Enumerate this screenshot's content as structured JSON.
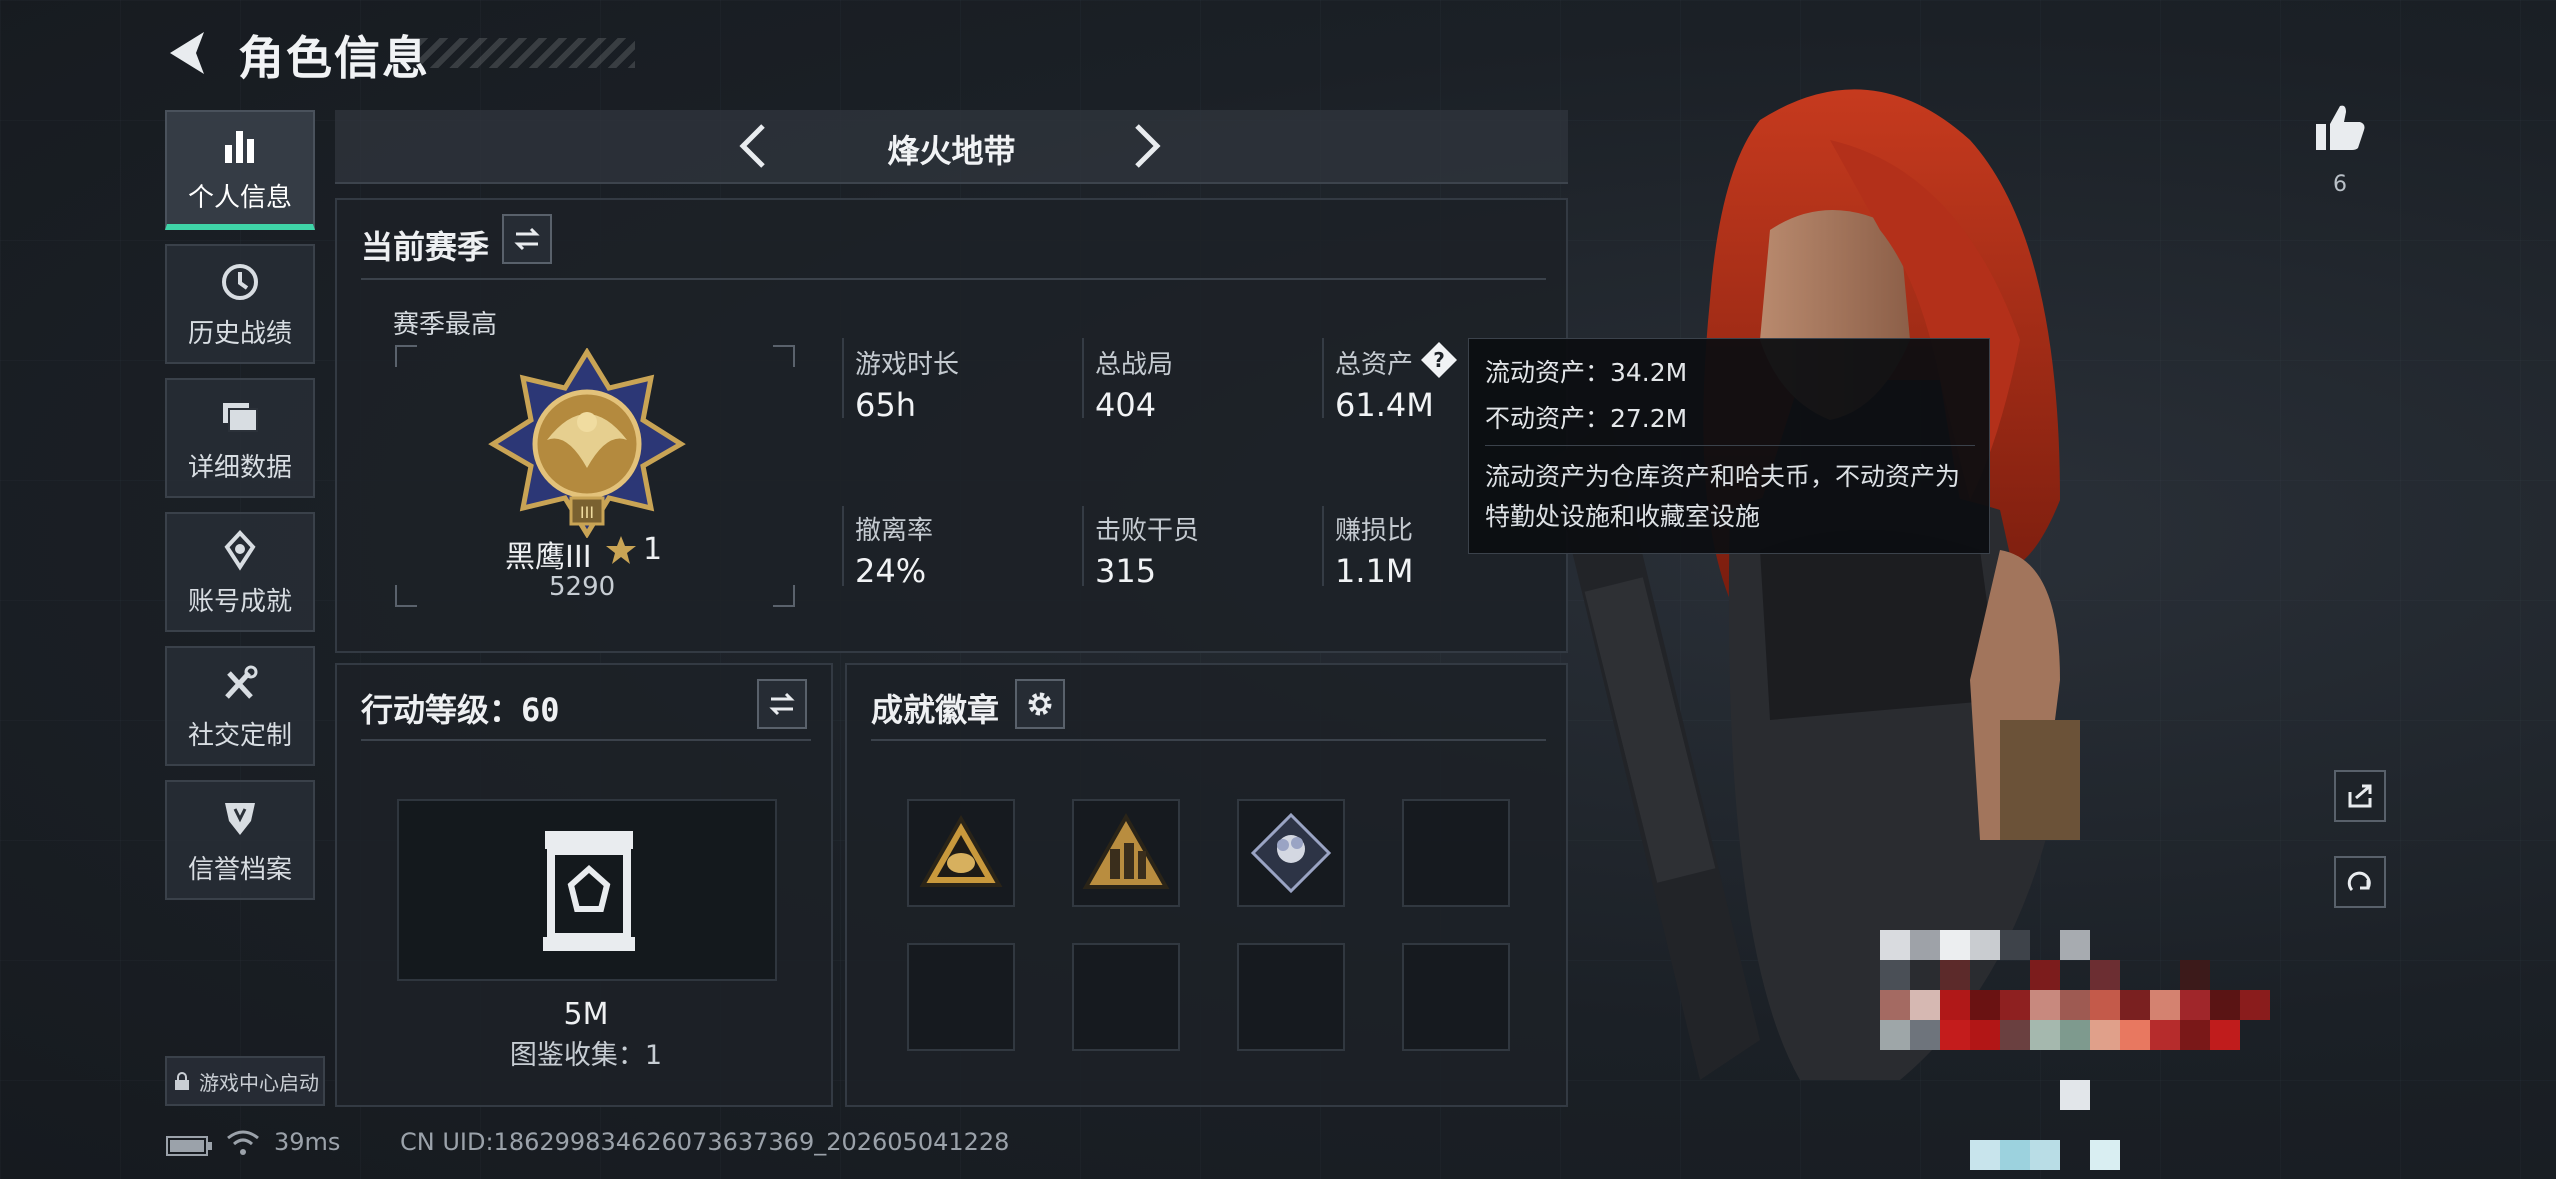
{
  "header": {
    "title": "角色信息"
  },
  "sidebar": {
    "items": [
      {
        "label": "个人信息",
        "icon": "bar-chart-icon",
        "active": true
      },
      {
        "label": "历史战绩",
        "icon": "clock-icon",
        "active": false
      },
      {
        "label": "详细数据",
        "icon": "folder-icon",
        "active": false
      },
      {
        "label": "账号成就",
        "icon": "achievement-icon",
        "active": false
      },
      {
        "label": "社交定制",
        "icon": "tools-icon",
        "active": false
      },
      {
        "label": "信誉档案",
        "icon": "shield-icon",
        "active": false
      }
    ],
    "launch_label": "游戏中心启动"
  },
  "mode": {
    "title": "烽火地带"
  },
  "season": {
    "title": "当前赛季",
    "best_label": "赛季最高",
    "rank_name": "黑鹰III",
    "rank_stars": "1",
    "rank_score": "5290",
    "stats": [
      {
        "label": "游戏时长",
        "value": "65h"
      },
      {
        "label": "总战局",
        "value": "404"
      },
      {
        "label": "总资产",
        "value": "61.4M"
      },
      {
        "label": "撤离率",
        "value": "24%"
      },
      {
        "label": "击败干员",
        "value": "315"
      },
      {
        "label": "赚损比",
        "value": "1.1M"
      }
    ]
  },
  "tooltip": {
    "liquid": "流动资产：34.2M",
    "fixed": "不动资产：27.2M",
    "description": "流动资产为仓库资产和哈夫币，不动资产为特勤处设施和收藏室设施"
  },
  "action_level": {
    "title": "行动等级：60",
    "value": "5M",
    "collection": "图鉴收集：1"
  },
  "badges": {
    "title": "成就徽章",
    "slots": [
      "triangle-egg-badge",
      "triangle-soldiers-badge",
      "diamond-flower-badge",
      "",
      "",
      "",
      "",
      ""
    ]
  },
  "likes": {
    "count": "6"
  },
  "footer": {
    "ping": "39ms",
    "uid": "CN UID:1862998346260736373​69_202605041228"
  },
  "colors": {
    "accent": "#3fd5a8",
    "gold": "#c9a455",
    "hair": "#b5321c"
  }
}
